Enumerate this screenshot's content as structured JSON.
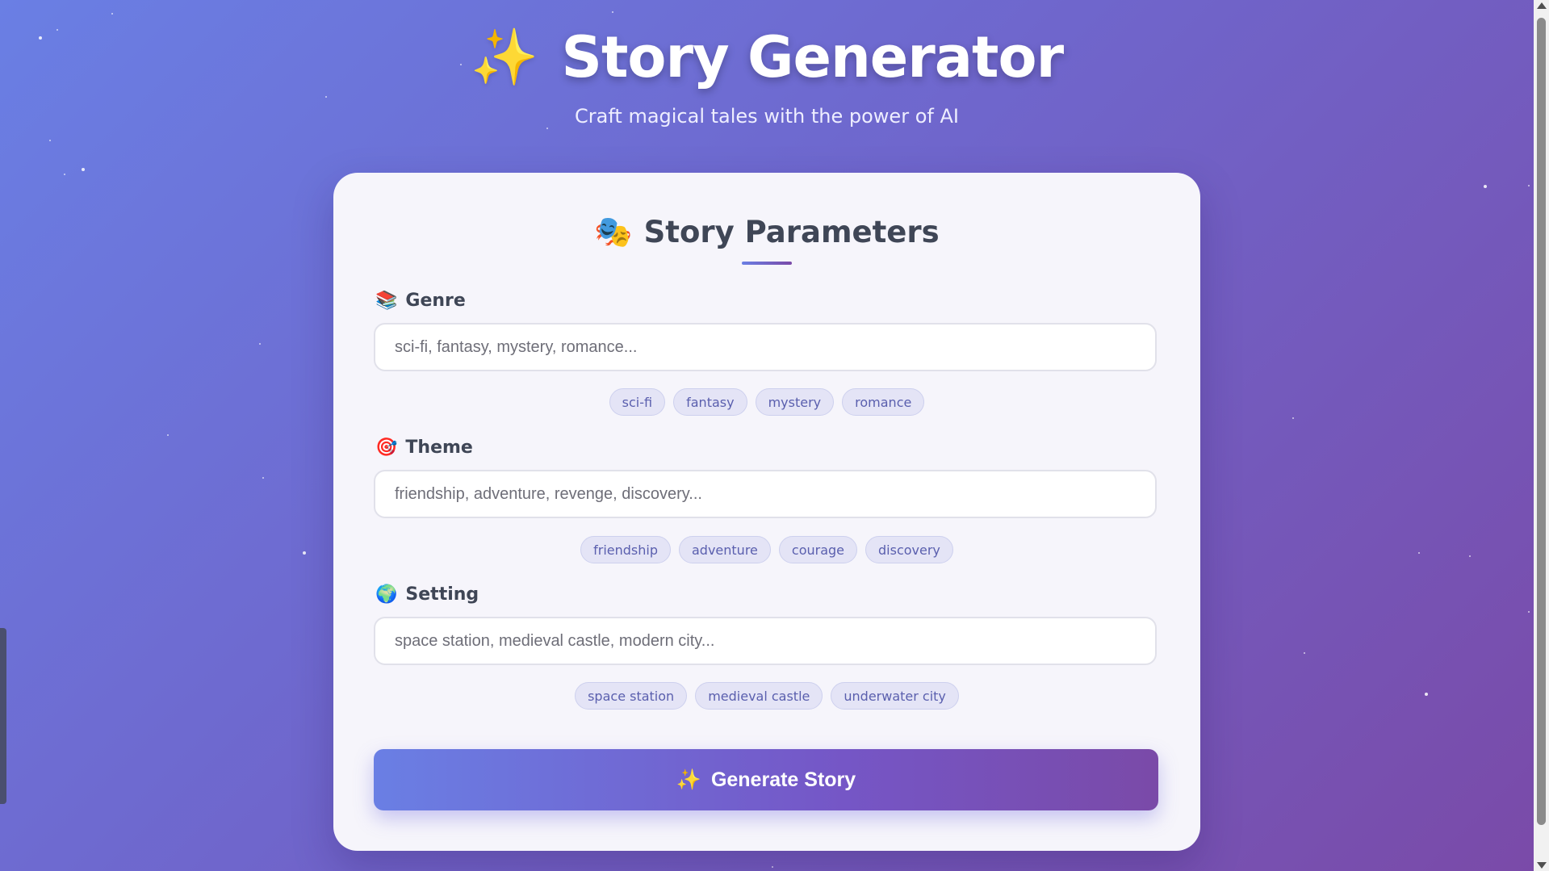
{
  "header": {
    "icon": "sparkles-icon",
    "icon_glyph": "✨",
    "title": "Story Generator",
    "subtitle": "Craft magical tales with the power of AI"
  },
  "card": {
    "title_icon": "theater-masks-icon",
    "title_icon_glyph": "🎭",
    "title": "Story Parameters"
  },
  "fields": {
    "genre": {
      "icon": "books-icon",
      "icon_glyph": "📚",
      "label": "Genre",
      "value": "",
      "placeholder": "sci-fi, fantasy, mystery, romance...",
      "chips": [
        "sci-fi",
        "fantasy",
        "mystery",
        "romance"
      ]
    },
    "theme": {
      "icon": "target-icon",
      "icon_glyph": "🎯",
      "label": "Theme",
      "value": "",
      "placeholder": "friendship, adventure, revenge, discovery...",
      "chips": [
        "friendship",
        "adventure",
        "courage",
        "discovery"
      ]
    },
    "setting": {
      "icon": "globe-icon",
      "icon_glyph": "🌍",
      "label": "Setting",
      "value": "",
      "placeholder": "space station, medieval castle, modern city...",
      "chips": [
        "space station",
        "medieval castle",
        "underwater city"
      ]
    }
  },
  "generate_button": {
    "icon": "sparkles-icon",
    "icon_glyph": "✨",
    "label": "Generate Story"
  },
  "colors": {
    "bg_start": "#6a7fe4",
    "bg_end": "#7a4aa8",
    "card_bg": "#f6f5fb",
    "chip_text": "#5a5fae"
  }
}
